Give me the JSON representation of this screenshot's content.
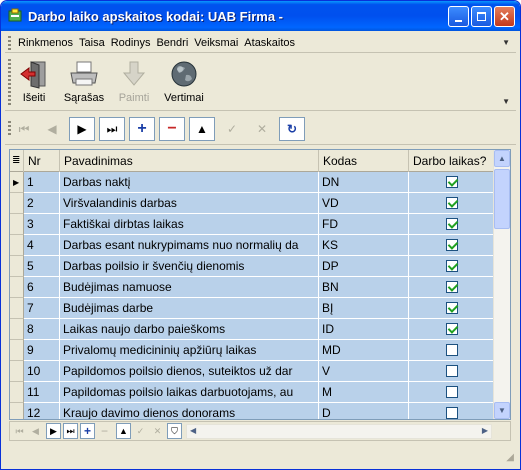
{
  "window": {
    "title": "Darbo laiko apskaitos kodai:  UAB Firma -"
  },
  "title_buttons": {
    "minimize": "_",
    "maximize": "□",
    "close": "✕"
  },
  "menubar": {
    "items": [
      "Rinkmenos",
      "Taisa",
      "Rodinys",
      "Bendri",
      "Veiksmai",
      "Ataskaitos"
    ]
  },
  "toolbar": {
    "items": [
      {
        "label": "Išeiti",
        "icon": "exit-door-icon",
        "enabled": true
      },
      {
        "label": "Sąrašas",
        "icon": "printer-icon",
        "enabled": true
      },
      {
        "label": "Paimti",
        "icon": "down-arrow-icon",
        "enabled": false
      },
      {
        "label": "Vertimai",
        "icon": "globe-icon",
        "enabled": true
      }
    ]
  },
  "navbar": {
    "buttons": [
      {
        "symbol": "⏮",
        "name": "first-icon",
        "enabled": false
      },
      {
        "symbol": "◀",
        "name": "prior-icon",
        "enabled": false
      },
      {
        "symbol": "▶",
        "name": "next-icon",
        "enabled": true
      },
      {
        "symbol": "⏭",
        "name": "last-icon",
        "enabled": true
      },
      {
        "symbol": "+",
        "name": "insert-icon",
        "enabled": true
      },
      {
        "symbol": "−",
        "name": "delete-icon",
        "enabled": true
      },
      {
        "symbol": "▲",
        "name": "edit-icon",
        "enabled": true
      },
      {
        "symbol": "✓",
        "name": "post-icon",
        "enabled": false
      },
      {
        "symbol": "✕",
        "name": "cancel-icon",
        "enabled": false
      },
      {
        "symbol": "↻",
        "name": "refresh-icon",
        "enabled": true
      }
    ]
  },
  "grid": {
    "columns": [
      "Nr",
      "Pavadinimas",
      "Kodas",
      "Darbo laikas?"
    ],
    "rows": [
      {
        "nr": "1",
        "name": "Darbas naktį",
        "code": "DN",
        "work": true
      },
      {
        "nr": "2",
        "name": "Viršvalandinis darbas",
        "code": "VD",
        "work": true
      },
      {
        "nr": "3",
        "name": "Faktiškai dirbtas laikas",
        "code": "FD",
        "work": true
      },
      {
        "nr": "4",
        "name": "Darbas esant nukrypimams nuo normalių da",
        "code": "KS",
        "work": true
      },
      {
        "nr": "5",
        "name": "Darbas poilsio ir švenčių dienomis",
        "code": "DP",
        "work": true
      },
      {
        "nr": "6",
        "name": "Budėjimas namuose",
        "code": "BN",
        "work": true
      },
      {
        "nr": "7",
        "name": "Budėjimas darbe",
        "code": "BĮ",
        "work": true
      },
      {
        "nr": "8",
        "name": "Laikas naujo darbo paieškoms",
        "code": "ID",
        "work": true
      },
      {
        "nr": "9",
        "name": "Privalomų medicininių apžiūrų laikas",
        "code": "MD",
        "work": false
      },
      {
        "nr": "10",
        "name": "Papildomos poilsio dienos, suteiktos už dar",
        "code": "V",
        "work": false
      },
      {
        "nr": "11",
        "name": "Papildomas poilsio laikas darbuotojams, au",
        "code": "M",
        "work": false
      },
      {
        "nr": "12",
        "name": "Kraujo davimo dienos donorams",
        "code": "D",
        "work": false
      }
    ]
  },
  "bottomnav": {
    "buttons": [
      "⏮",
      "◀",
      "▶",
      "⏭",
      "+",
      "−",
      "▲",
      "✓",
      "✕",
      "⛉"
    ]
  },
  "colors": {
    "titlebar": "#0053ee",
    "selection": "#b9d1ea",
    "window_bg": "#ece9d8"
  }
}
